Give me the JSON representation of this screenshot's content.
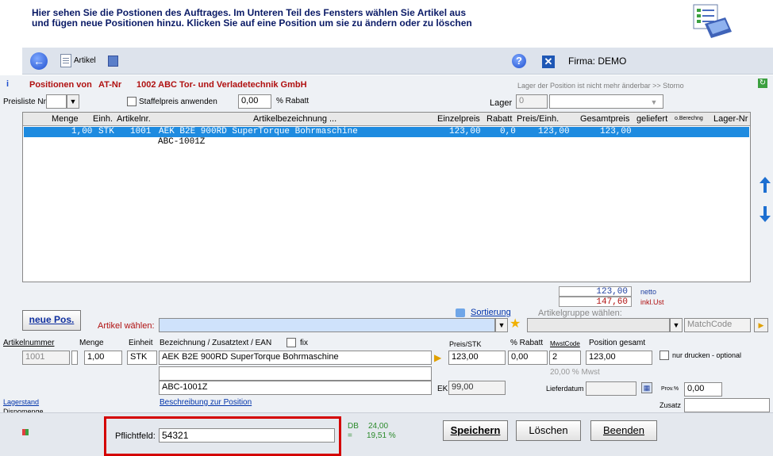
{
  "intro": {
    "line1": "Hier sehen Sie die Postionen des Auftrages. Im Unteren Teil des Fensters wählen Sie Artikel aus",
    "line2": "und fügen neue Positionen hinzu. Klicken Sie auf eine Position um sie zu ändern oder zu löschen"
  },
  "toolbar": {
    "artikel_label": "Artikel",
    "firma": "Firma: DEMO"
  },
  "header": {
    "positions_label": "Positionen von",
    "at_nr": "AT-Nr",
    "customer": "1002 ABC Tor- und Verladetechnik GmbH",
    "lager_note": "Lager der Position ist nicht mehr änderbar >> Storno"
  },
  "filters": {
    "preisliste_label": "Preisliste Nr.",
    "staffelpreis_label": "Staffelpreis anwenden",
    "rabatt_value": "0,00",
    "rabatt_label": "% Rabatt",
    "lager_label": "Lager",
    "lager_value": "0"
  },
  "grid": {
    "columns": [
      "Menge",
      "Einh.",
      "Artikelnr.",
      "Artikelbezeichnung ...",
      "Einzelpreis",
      "Rabatt",
      "Preis/Einh.",
      "Gesamtpreis",
      "geliefert",
      "o.Berechng",
      "Lager-Nr"
    ],
    "row": {
      "menge": "1,00",
      "einh": "STK",
      "artikelnr": "1001",
      "bezeichnung": "AEK  B2E 900RD SuperTorque Bohrmaschine",
      "zusatz": "ABC-1001Z",
      "einzelpreis": "123,00",
      "rabatt": "0,0",
      "preis_einh": "123,00",
      "gesamtpreis": "123,00"
    }
  },
  "totals": {
    "netto_value": "123,00",
    "netto_label": "netto",
    "brutto_value": "147,60",
    "brutto_label": "inkl.Ust"
  },
  "editor": {
    "neue_pos": "neue Pos.",
    "artikel_waehlen": "Artikel wählen:",
    "sortierung": "Sortierung",
    "artikelgruppe": "Artikelgruppe wählen:",
    "matchcode": "MatchCode",
    "artikelnummer_label": "Artikelnummer",
    "menge_label": "Menge",
    "einheit_label": "Einheit",
    "bezeichnung_label": "Bezeichnung / Zusatztext / EAN",
    "fix_label": "fix",
    "preis_label": "Preis/STK",
    "rabatt_label": "% Rabatt",
    "mwstcode_label": "MwstCode",
    "position_gesamt_label": "Position gesamt",
    "artikelnummer": "1001",
    "menge": "1,00",
    "einheit": "STK",
    "bezeichnung": "AEK  B2E 900RD SuperTorque Bohrmaschine",
    "zusatztext": "",
    "ean": "ABC-1001Z",
    "preis": "123,00",
    "rabatt": "0,00",
    "mwstcode": "2",
    "position_gesamt": "123,00",
    "nur_drucken": "nur drucken - optional",
    "mwst_note": "20,00 % Mwst",
    "ek_label": "EK",
    "ek_value": "99,00",
    "lieferdatum_label": "Lieferdatum",
    "prov_label": "Prov.%",
    "prov_value": "0,00",
    "zusatz_label": "Zusatz",
    "lagerstand": "Lagerstand",
    "dispomenge": "Dispomenge",
    "beschreibung_link": "Beschreibung zur Position"
  },
  "footer": {
    "pflichtfeld_label": "Pflichtfeld:",
    "pflichtfeld_value": "54321",
    "db_label": "DB",
    "db_value": "24,00",
    "db_eq": "=",
    "db_percent": "19,51 %",
    "speichern": "Speichern",
    "loeschen": "Löschen",
    "beenden": "Beenden"
  },
  "colors": {
    "selection": "#1e8be0",
    "highlight_border": "#d40000",
    "title_red": "#b01010",
    "link_blue": "#0033aa"
  }
}
